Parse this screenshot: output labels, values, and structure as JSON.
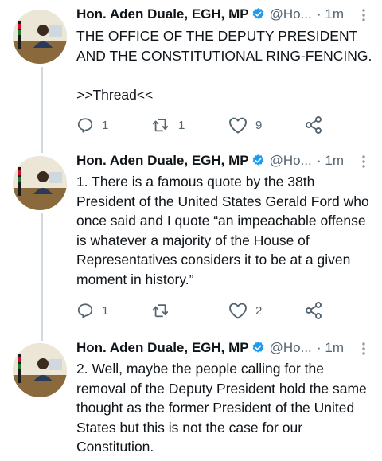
{
  "tweets": [
    {
      "author": "Hon. Aden Duale, EGH, MP",
      "handle": "@Ho...",
      "time": "· 1m",
      "text": "THE OFFICE OF THE DEPUTY PRESIDENT AND THE CONSTITUTIONAL RING-FENCING.\n\n>>Thread<<",
      "replies": "1",
      "retweets": "1",
      "likes": "9"
    },
    {
      "author": "Hon. Aden Duale, EGH, MP",
      "handle": "@Ho...",
      "time": "· 1m",
      "text": "1. There is a famous quote by the 38th President of the United States Gerald Ford who once said and I quote “an impeachable offense is whatever a majority of the House of Representatives considers it to be at a given moment in history.”",
      "replies": "1",
      "retweets": "",
      "likes": "2"
    },
    {
      "author": "Hon. Aden Duale, EGH, MP",
      "handle": "@Ho...",
      "time": "· 1m",
      "text": "2. Well, maybe the people calling for the removal of the Deputy President hold the same thought as the former President of the United States but this is not the case for our Constitution."
    }
  ],
  "icons": {
    "verified": "verified-badge-icon",
    "more": "more-vertical-icon",
    "reply": "reply-icon",
    "retweet": "retweet-icon",
    "like": "heart-icon",
    "share": "share-icon"
  },
  "colors": {
    "verified": "#1d9bf0",
    "thread_line": "#cfd9de",
    "secondary_text": "#536471"
  }
}
